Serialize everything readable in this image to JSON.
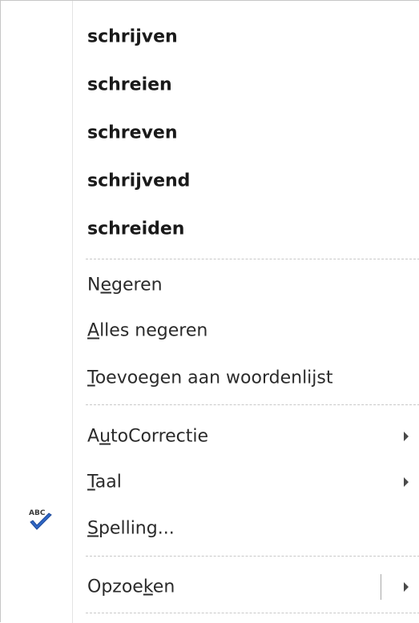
{
  "suggestions": [
    {
      "text": "schrijven"
    },
    {
      "text": "schreien"
    },
    {
      "text": "schreven"
    },
    {
      "text": "schrijvend"
    },
    {
      "text": "schreiden"
    }
  ],
  "menu": {
    "ignore": {
      "pre": "N",
      "ul": "e",
      "post": "geren"
    },
    "ignore_all": {
      "pre": "",
      "ul": "A",
      "post": "lles negeren"
    },
    "add_to_dict": {
      "pre": "",
      "ul": "T",
      "post": "oevoegen aan woordenlijst"
    },
    "autocorrect": {
      "pre": "A",
      "ul": "u",
      "post": "toCorrectie"
    },
    "language": {
      "pre": "",
      "ul": "T",
      "post": "aal"
    },
    "spelling": {
      "pre": "",
      "ul": "S",
      "post": "pelling..."
    },
    "lookup": {
      "pre": "Opzoe",
      "ul": "k",
      "post": "en"
    }
  },
  "icons": {
    "spelling": "abc-check-icon",
    "submenu": "chevron-right-icon"
  },
  "colors": {
    "check_blue": "#2f66c4",
    "text": "#2b2b2b"
  }
}
